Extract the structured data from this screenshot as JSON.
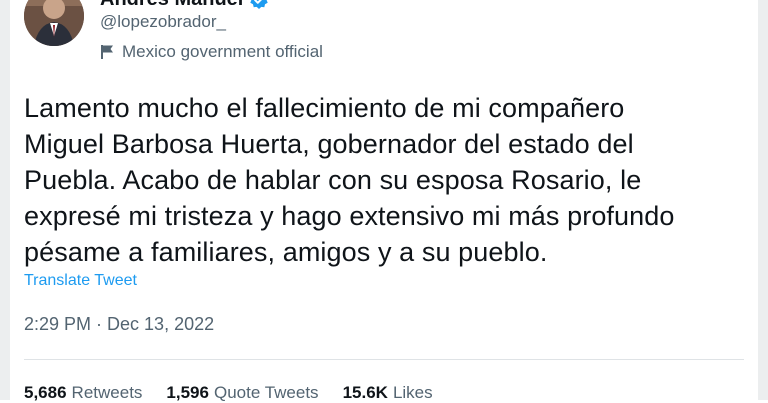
{
  "author": {
    "display_name": "Andrés Manuel",
    "handle": "@lopezobrador_",
    "label": "Mexico government official",
    "verified_icon": "verified-badge-icon",
    "label_icon": "flag-icon"
  },
  "tweet": {
    "lines": [
      "Lamento mucho el fallecimiento de mi compañero",
      "Miguel Barbosa Huerta, gobernador del estado del",
      "Puebla. Acabo de hablar con su esposa Rosario, le",
      "expresé mi tristeza y hago extensivo mi más profundo",
      "pésame a familiares, amigos y a su pueblo."
    ],
    "translate": "Translate Tweet",
    "timestamp": "2:29 PM · Dec 13, 2022"
  },
  "stats": [
    {
      "count": "5,686",
      "label": "Retweets"
    },
    {
      "count": "1,596",
      "label": "Quote Tweets"
    },
    {
      "count": "15.6K",
      "label": "Likes"
    }
  ],
  "colors": {
    "link": "#1d9bf0",
    "secondary_text": "#536471",
    "primary_text": "#0f1419",
    "divider": "#dfe3e6"
  }
}
